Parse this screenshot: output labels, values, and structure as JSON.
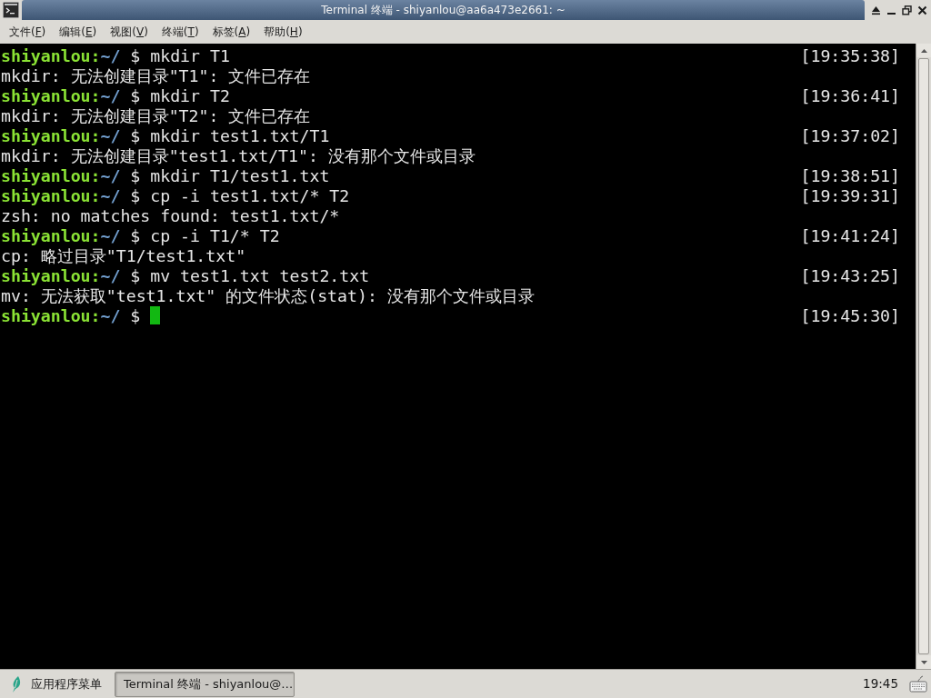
{
  "window": {
    "title": "Terminal 终端 - shiyanlou@aa6a473e2661: ~"
  },
  "menu": [
    {
      "label_start": "文件(",
      "mnemonic": "F",
      "label_end": ")"
    },
    {
      "label_start": "编辑(",
      "mnemonic": "E",
      "label_end": ")"
    },
    {
      "label_start": "视图(",
      "mnemonic": "V",
      "label_end": ")"
    },
    {
      "label_start": "终端(",
      "mnemonic": "T",
      "label_end": ")"
    },
    {
      "label_start": "标签(",
      "mnemonic": "A",
      "label_end": ")"
    },
    {
      "label_start": "帮助(",
      "mnemonic": "H",
      "label_end": ")"
    }
  ],
  "terminal": {
    "lines": [
      {
        "kind": "prompt",
        "user": "shiyanlou",
        "separator": ":",
        "path": "~/",
        "symbol": "$",
        "command": "mkdir T1",
        "cursor": false,
        "time": "[19:35:38]"
      },
      {
        "kind": "output",
        "text": "mkdir: 无法创建目录\"T1\": 文件已存在"
      },
      {
        "kind": "prompt",
        "user": "shiyanlou",
        "separator": ":",
        "path": "~/",
        "symbol": "$",
        "command": "mkdir T2",
        "cursor": false,
        "time": "[19:36:41]"
      },
      {
        "kind": "output",
        "text": "mkdir: 无法创建目录\"T2\": 文件已存在"
      },
      {
        "kind": "prompt",
        "user": "shiyanlou",
        "separator": ":",
        "path": "~/",
        "symbol": "$",
        "command": "mkdir test1.txt/T1",
        "cursor": false,
        "time": "[19:37:02]"
      },
      {
        "kind": "output",
        "text": "mkdir: 无法创建目录\"test1.txt/T1\": 没有那个文件或目录"
      },
      {
        "kind": "prompt",
        "user": "shiyanlou",
        "separator": ":",
        "path": "~/",
        "symbol": "$",
        "command": "mkdir T1/test1.txt",
        "cursor": false,
        "time": "[19:38:51]"
      },
      {
        "kind": "prompt",
        "user": "shiyanlou",
        "separator": ":",
        "path": "~/",
        "symbol": "$",
        "command": "cp -i test1.txt/* T2",
        "cursor": false,
        "time": "[19:39:31]"
      },
      {
        "kind": "output",
        "text": "zsh: no matches found: test1.txt/*"
      },
      {
        "kind": "prompt",
        "user": "shiyanlou",
        "separator": ":",
        "path": "~/",
        "symbol": "$",
        "command": "cp -i T1/* T2",
        "cursor": false,
        "time": "[19:41:24]"
      },
      {
        "kind": "output",
        "text": "cp: 略过目录\"T1/test1.txt\""
      },
      {
        "kind": "prompt",
        "user": "shiyanlou",
        "separator": ":",
        "path": "~/",
        "symbol": "$",
        "command": "mv test1.txt test2.txt",
        "cursor": false,
        "time": "[19:43:25]"
      },
      {
        "kind": "output",
        "text": "mv: 无法获取\"test1.txt\" 的文件状态(stat): 没有那个文件或目录"
      },
      {
        "kind": "prompt",
        "user": "shiyanlou",
        "separator": ":",
        "path": "~/",
        "symbol": "$",
        "cursor": true,
        "time": "[19:45:30]"
      }
    ]
  },
  "taskbar": {
    "app_menu": "应用程序菜单",
    "tasks": [
      {
        "label": "Terminal 终端 - shiyanlou@…",
        "selected": true
      }
    ],
    "clock": "19:45"
  }
}
